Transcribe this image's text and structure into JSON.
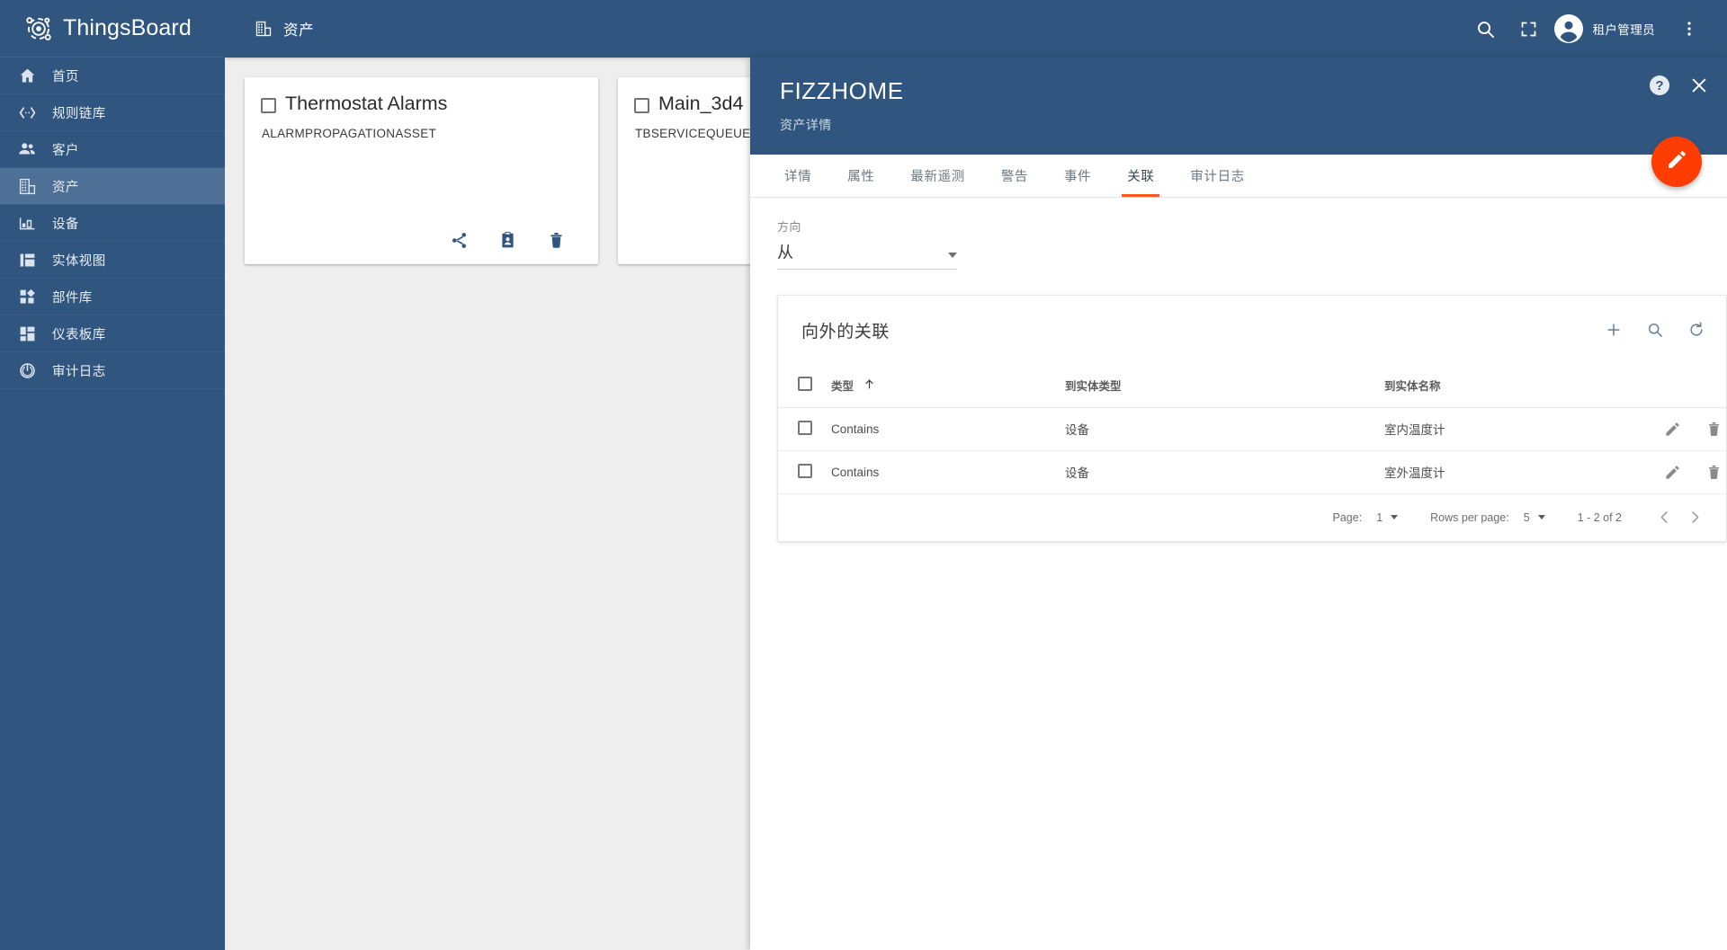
{
  "brand": {
    "name": "ThingsBoard",
    "logo_icon": "thingsboard-logo-icon"
  },
  "sidebar": {
    "items": [
      {
        "label": "首页",
        "icon": "home-icon",
        "active": false
      },
      {
        "label": "规则链库",
        "icon": "rule-chain-icon",
        "active": false
      },
      {
        "label": "客户",
        "icon": "customers-icon",
        "active": false
      },
      {
        "label": "资产",
        "icon": "assets-icon",
        "active": true
      },
      {
        "label": "设备",
        "icon": "devices-icon",
        "active": false
      },
      {
        "label": "实体视图",
        "icon": "entity-view-icon",
        "active": false
      },
      {
        "label": "部件库",
        "icon": "widget-library-icon",
        "active": false
      },
      {
        "label": "仪表板库",
        "icon": "dashboard-library-icon",
        "active": false
      },
      {
        "label": "审计日志",
        "icon": "audit-log-icon",
        "active": false
      }
    ]
  },
  "topbar": {
    "title": "资产",
    "title_icon": "assets-icon",
    "search_icon": "search-icon",
    "fullscreen_icon": "fullscreen-icon",
    "avatar_icon": "account-circle-icon",
    "user_name": "租户管理员",
    "more_icon": "more-vert-icon"
  },
  "cards": [
    {
      "title": "Thermostat Alarms",
      "subtitle": "ALARMPROPAGATIONASSET",
      "actions": [
        {
          "name": "share-icon"
        },
        {
          "name": "assign-customer-icon"
        },
        {
          "name": "delete-icon"
        }
      ]
    },
    {
      "title": "Main_3d4",
      "subtitle": "TBSERVICEQUEUE",
      "actions": []
    }
  ],
  "detail": {
    "title": "FIZZHOME",
    "subtitle": "资产详情",
    "help_icon": "help-icon",
    "help_glyph": "?",
    "close_icon": "close-icon",
    "fab_icon": "edit-pencil-icon",
    "tabs": [
      {
        "label": "详情",
        "active": false
      },
      {
        "label": "属性",
        "active": false
      },
      {
        "label": "最新遥测",
        "active": false
      },
      {
        "label": "警告",
        "active": false
      },
      {
        "label": "事件",
        "active": false
      },
      {
        "label": "关联",
        "active": true
      },
      {
        "label": "审计日志",
        "active": false
      }
    ],
    "direction_field": {
      "label": "方向",
      "value": "从"
    },
    "relations_card": {
      "title": "向外的关联",
      "toolbar": [
        {
          "name": "add-icon"
        },
        {
          "name": "search-icon"
        },
        {
          "name": "refresh-icon"
        }
      ],
      "columns": [
        "类型",
        "到实体类型",
        "到实体名称"
      ],
      "sort_column": "类型",
      "sort_direction": "asc",
      "rows": [
        {
          "type": "Contains",
          "entity_type": "设备",
          "entity_name": "室内温度计"
        },
        {
          "type": "Contains",
          "entity_type": "设备",
          "entity_name": "室外温度计"
        }
      ],
      "paginator": {
        "page_label": "Page:",
        "page_value": "1",
        "rows_per_page_label": "Rows per page:",
        "rows_per_page_value": "5",
        "range": "1 - 2 of 2",
        "prev_icon": "chevron-left-icon",
        "next_icon": "chevron-right-icon"
      }
    }
  },
  "colors": {
    "primary": "#305680",
    "sidebar_active": "#4e6f96",
    "accent": "#ff5722",
    "fab": "#ff3d00",
    "content_bg": "#eeeeee"
  }
}
